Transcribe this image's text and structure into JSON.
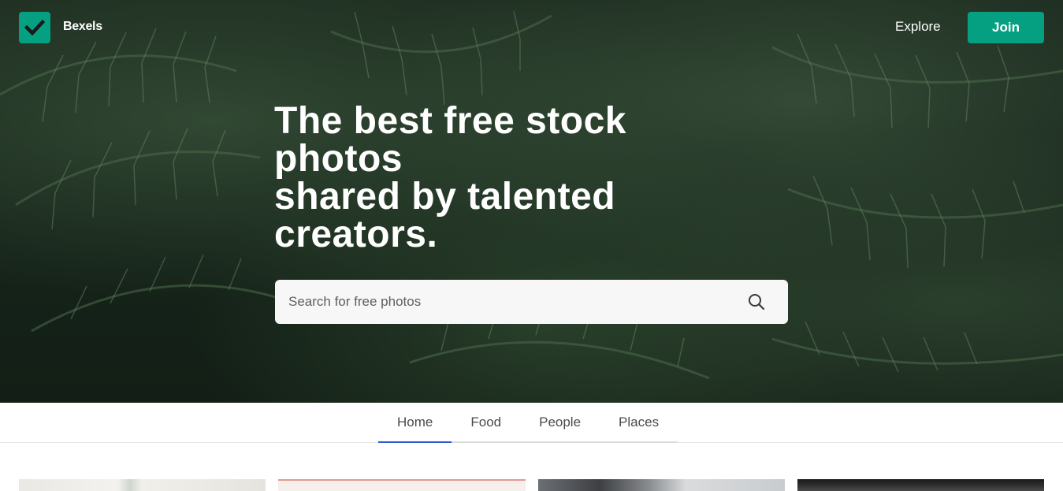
{
  "header": {
    "brand": "Bexels",
    "logo_icon": "checkmark-icon",
    "nav_explore": "Explore",
    "join_label": "Join"
  },
  "hero": {
    "headline_lines": [
      "The best free stock",
      "photos",
      "shared by talented",
      "creators."
    ],
    "search_placeholder": "Search for free photos",
    "search_icon": "search-icon"
  },
  "tabs": [
    {
      "label": "Home",
      "active": true
    },
    {
      "label": "Food",
      "active": false
    },
    {
      "label": "People",
      "active": false
    },
    {
      "label": "Places",
      "active": false
    }
  ],
  "colors": {
    "accent": "#05a081",
    "active_tab": "#2c5cc5"
  }
}
